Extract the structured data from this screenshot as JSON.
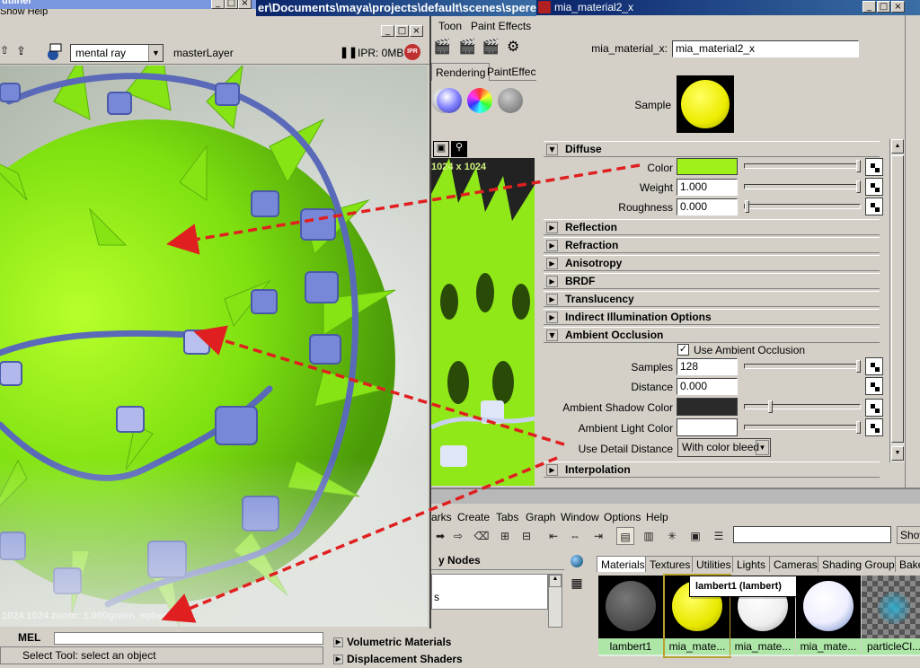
{
  "background": {
    "outliner_title": "utliner",
    "outliner_menu": "Show  Help",
    "maya_title": "er\\Documents\\maya\\projects\\default\\scenes\\sperec"
  },
  "render_view": {
    "renderer": "mental ray",
    "layer": "masterLayer",
    "ipr_label": "IPR: 0MB",
    "ipr_icon": "IPR",
    "status": "1024 1024 zoom: 1.000green_sphere.png"
  },
  "middle_editor": {
    "menu": [
      "Toon",
      "Paint Effects"
    ],
    "tabs": [
      "Rendering",
      "PaintEffect"
    ],
    "resolution": "1024 x 1024"
  },
  "attribute_editor": {
    "title": "mia_material2_x",
    "node_label": "mia_material_x:",
    "node_value": "mia_material2_x",
    "sample_label": "Sample",
    "diffuse": {
      "header": "Diffuse",
      "color_label": "Color",
      "color_value": "#9ef21a",
      "weight_label": "Weight",
      "weight_value": "1.000",
      "roughness_label": "Roughness",
      "roughness_value": "0.000"
    },
    "collapsed_sections": [
      "Reflection",
      "Refraction",
      "Anisotropy",
      "BRDF",
      "Translucency",
      "Indirect Illumination Options"
    ],
    "ao": {
      "header": "Ambient Occlusion",
      "use_label": "Use Ambient Occlusion",
      "samples_label": "Samples",
      "samples_value": "128",
      "distance_label": "Distance",
      "distance_value": "0.000",
      "shadow_label": "Ambient Shadow Color",
      "shadow_color": "#2a2a2a",
      "light_label": "Ambient Light Color",
      "light_color": "#ffffff",
      "detail_label": "Use Detail Distance",
      "detail_value": "With color bleed"
    },
    "interpolation": "Interpolation"
  },
  "hypershade": {
    "menu": [
      "arks",
      "Create",
      "Tabs",
      "Graph",
      "Window",
      "Options",
      "Help"
    ],
    "show_label": "Show",
    "tree_header": "y Nodes",
    "tree_partial": "s",
    "tabs": [
      "Materials",
      "Textures",
      "Utilities",
      "Lights",
      "Cameras",
      "Shading Groups",
      "Bake"
    ],
    "swatches": [
      "lambert1",
      "mia_mate...",
      "mia_mate...",
      "mia_mate...",
      "particleCl..."
    ],
    "tooltip": "lambert1 (lambert)"
  },
  "bottom": {
    "mel_label": "MEL",
    "help_line": "Select Tool: select an object",
    "node_items": [
      "Volumetric Materials",
      "Displacement Shaders"
    ]
  },
  "colors": {
    "title_blue": "#0a246a",
    "arrow_red": "#e02020",
    "spiky_green": "#8ee016",
    "blue_cubes": "#6a78c8"
  }
}
